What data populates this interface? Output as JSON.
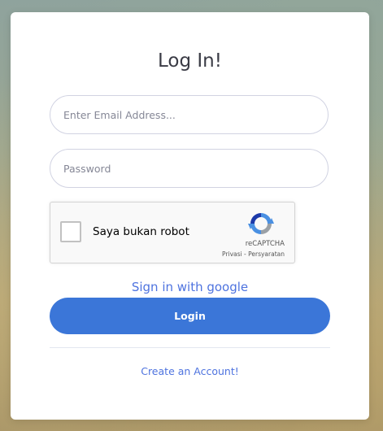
{
  "login": {
    "title": "Log In!",
    "email_placeholder": "Enter Email Address...",
    "password_placeholder": "Password",
    "google_link": "Sign in with google",
    "login_button": "Login",
    "create_account": "Create an Account!"
  },
  "captcha": {
    "label": "Saya bukan robot",
    "brand": "reCAPTCHA",
    "privacy": "Privasi",
    "separator": " - ",
    "terms": "Persyaratan",
    "checked": false
  },
  "colors": {
    "primary": "#3b76d8",
    "link": "#4e73df",
    "title": "#3a3b45"
  },
  "icons": {
    "captcha_logo": "recaptcha-logo-icon"
  }
}
